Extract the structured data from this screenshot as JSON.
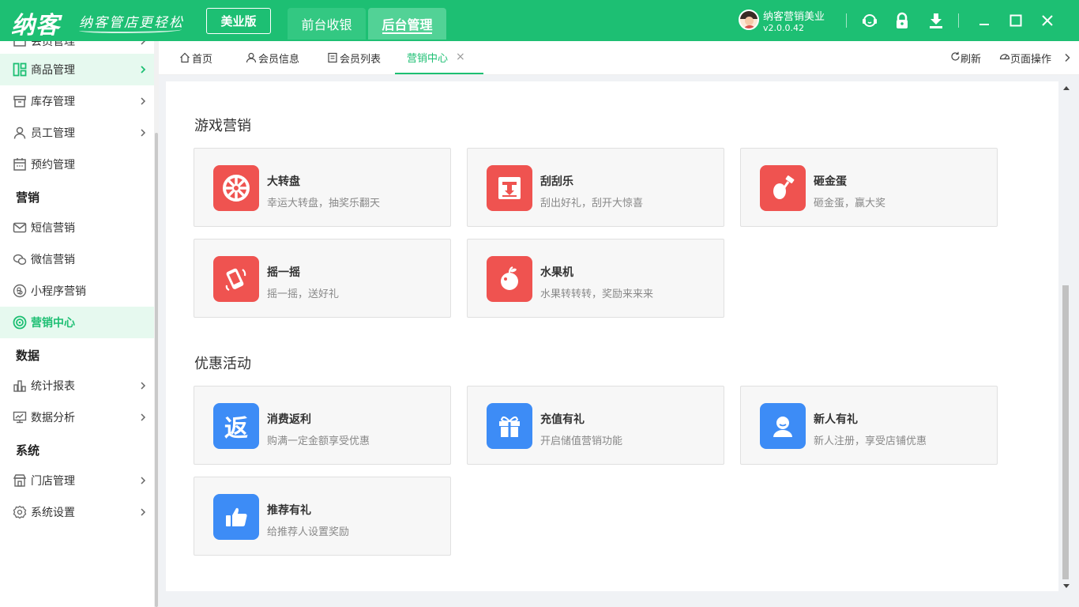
{
  "app": {
    "logo": "纳客",
    "slogan": "纳客管店更轻松",
    "edition": "美业版",
    "top_tabs": [
      "前台收银",
      "后台管理"
    ],
    "user_name": "纳客营销美业",
    "version": "v2.0.0.42",
    "brand_color": "#1dbf73"
  },
  "sidebar": {
    "partial_top": "会员管理",
    "items": [
      {
        "label": "商品管理",
        "icon": "goods-icon"
      },
      {
        "label": "库存管理",
        "icon": "inventory-icon"
      },
      {
        "label": "员工管理",
        "icon": "staff-icon"
      },
      {
        "label": "预约管理",
        "icon": "calendar-icon"
      },
      {
        "label": "短信营销",
        "icon": "mail-icon"
      },
      {
        "label": "微信营销",
        "icon": "wechat-icon"
      },
      {
        "label": "小程序营销",
        "icon": "miniapp-icon"
      },
      {
        "label": "营销中心",
        "icon": "target-icon"
      },
      {
        "label": "统计报表",
        "icon": "chart-icon"
      },
      {
        "label": "数据分析",
        "icon": "analysis-icon"
      },
      {
        "label": "门店管理",
        "icon": "store-icon"
      },
      {
        "label": "系统设置",
        "icon": "gear-icon"
      }
    ],
    "headers": [
      "营销",
      "数据",
      "系统"
    ]
  },
  "tabs": {
    "items": [
      "首页",
      "会员信息",
      "会员列表",
      "营销中心"
    ],
    "refresh": "刷新",
    "page_ops": "页面操作"
  },
  "sections": [
    {
      "title": "游戏营销",
      "cards": [
        {
          "title": "大转盘",
          "desc": "幸运大转盘，抽奖乐翻天",
          "icon": "wheel-icon",
          "color": "#ef5350"
        },
        {
          "title": "刮刮乐",
          "desc": "刮出好礼，刮开大惊喜",
          "icon": "scratch-card-icon",
          "color": "#ef5350"
        },
        {
          "title": "砸金蛋",
          "desc": "砸金蛋，赢大奖",
          "icon": "golden-egg-icon",
          "color": "#ef5350"
        },
        {
          "title": "摇一摇",
          "desc": "摇一摇，送好礼",
          "icon": "shake-phone-icon",
          "color": "#ef5350"
        },
        {
          "title": "水果机",
          "desc": "水果转转转，奖励来来来",
          "icon": "apple-icon",
          "color": "#ef5350"
        }
      ]
    },
    {
      "title": "优惠活动",
      "cards": [
        {
          "title": "消费返利",
          "desc": "购满一定金额享受优惠",
          "icon": "rebate-icon",
          "color": "#3d8cf6",
          "glyph": "返"
        },
        {
          "title": "充值有礼",
          "desc": "开启储值营销功能",
          "icon": "gift-icon",
          "color": "#3d8cf6"
        },
        {
          "title": "新人有礼",
          "desc": "新人注册，享受店铺优惠",
          "icon": "new-user-icon",
          "color": "#3d8cf6"
        },
        {
          "title": "推荐有礼",
          "desc": "给推荐人设置奖励",
          "icon": "thumbs-up-icon",
          "color": "#3d8cf6"
        }
      ]
    }
  ]
}
